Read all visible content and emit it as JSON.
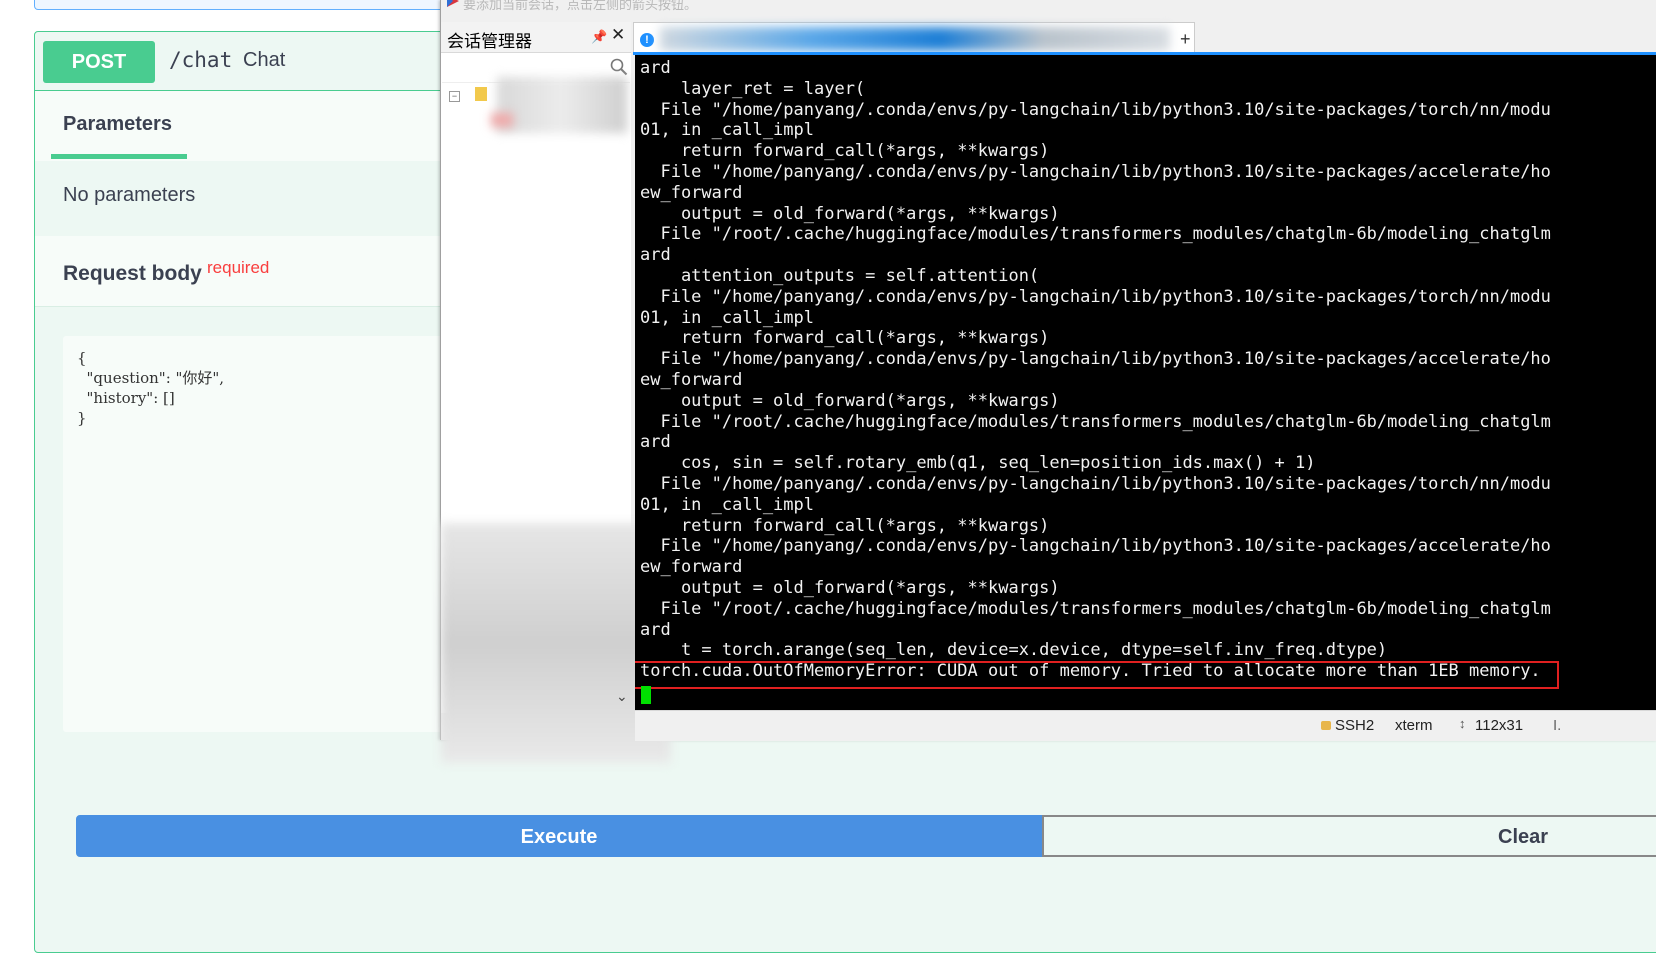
{
  "swagger": {
    "method": "POST",
    "path": "/chat",
    "summary": "Chat",
    "parameters_tab": "Parameters",
    "no_parameters": "No parameters",
    "request_body_title": "Request body",
    "request_body_required": "required",
    "request_body": "{\n  \"question\": \"你好\",\n  \"history\": []\n}",
    "execute_label": "Execute",
    "clear_label": "Clear"
  },
  "terminal_window": {
    "title_hint": "要添加当前会话，点击左侧的箭头按钮。",
    "session_manager_title": "会话管理器",
    "tab_info_symbol": "!",
    "tab_add_symbol": "+",
    "lines": [
      "ard",
      "    layer_ret = layer(",
      "  File \"/home/panyang/.conda/envs/py-langchain/lib/python3.10/site-packages/torch/nn/modu",
      "01, in _call_impl",
      "    return forward_call(*args, **kwargs)",
      "  File \"/home/panyang/.conda/envs/py-langchain/lib/python3.10/site-packages/accelerate/ho",
      "ew_forward",
      "    output = old_forward(*args, **kwargs)",
      "  File \"/root/.cache/huggingface/modules/transformers_modules/chatglm-6b/modeling_chatglm",
      "ard",
      "    attention_outputs = self.attention(",
      "  File \"/home/panyang/.conda/envs/py-langchain/lib/python3.10/site-packages/torch/nn/modu",
      "01, in _call_impl",
      "    return forward_call(*args, **kwargs)",
      "  File \"/home/panyang/.conda/envs/py-langchain/lib/python3.10/site-packages/accelerate/ho",
      "ew_forward",
      "    output = old_forward(*args, **kwargs)",
      "  File \"/root/.cache/huggingface/modules/transformers_modules/chatglm-6b/modeling_chatglm",
      "ard",
      "    cos, sin = self.rotary_emb(q1, seq_len=position_ids.max() + 1)",
      "  File \"/home/panyang/.conda/envs/py-langchain/lib/python3.10/site-packages/torch/nn/modu",
      "01, in _call_impl",
      "    return forward_call(*args, **kwargs)",
      "  File \"/home/panyang/.conda/envs/py-langchain/lib/python3.10/site-packages/accelerate/ho",
      "ew_forward",
      "    output = old_forward(*args, **kwargs)",
      "  File \"/root/.cache/huggingface/modules/transformers_modules/chatglm-6b/modeling_chatglm",
      "ard",
      "    t = torch.arange(seq_len, device=x.device, dtype=self.inv_freq.dtype)",
      "torch.cuda.OutOfMemoryError: CUDA out of memory. Tried to allocate more than 1EB memory."
    ],
    "status": {
      "protocol": "SSH2",
      "terminal_type": "xterm",
      "size": "112x31",
      "tail": "I."
    }
  },
  "colors": {
    "post_green": "#49cc90",
    "execute_blue": "#4990e2",
    "required_red": "#f93e3e",
    "error_highlight": "#e02020",
    "cursor_green": "#00e000"
  }
}
